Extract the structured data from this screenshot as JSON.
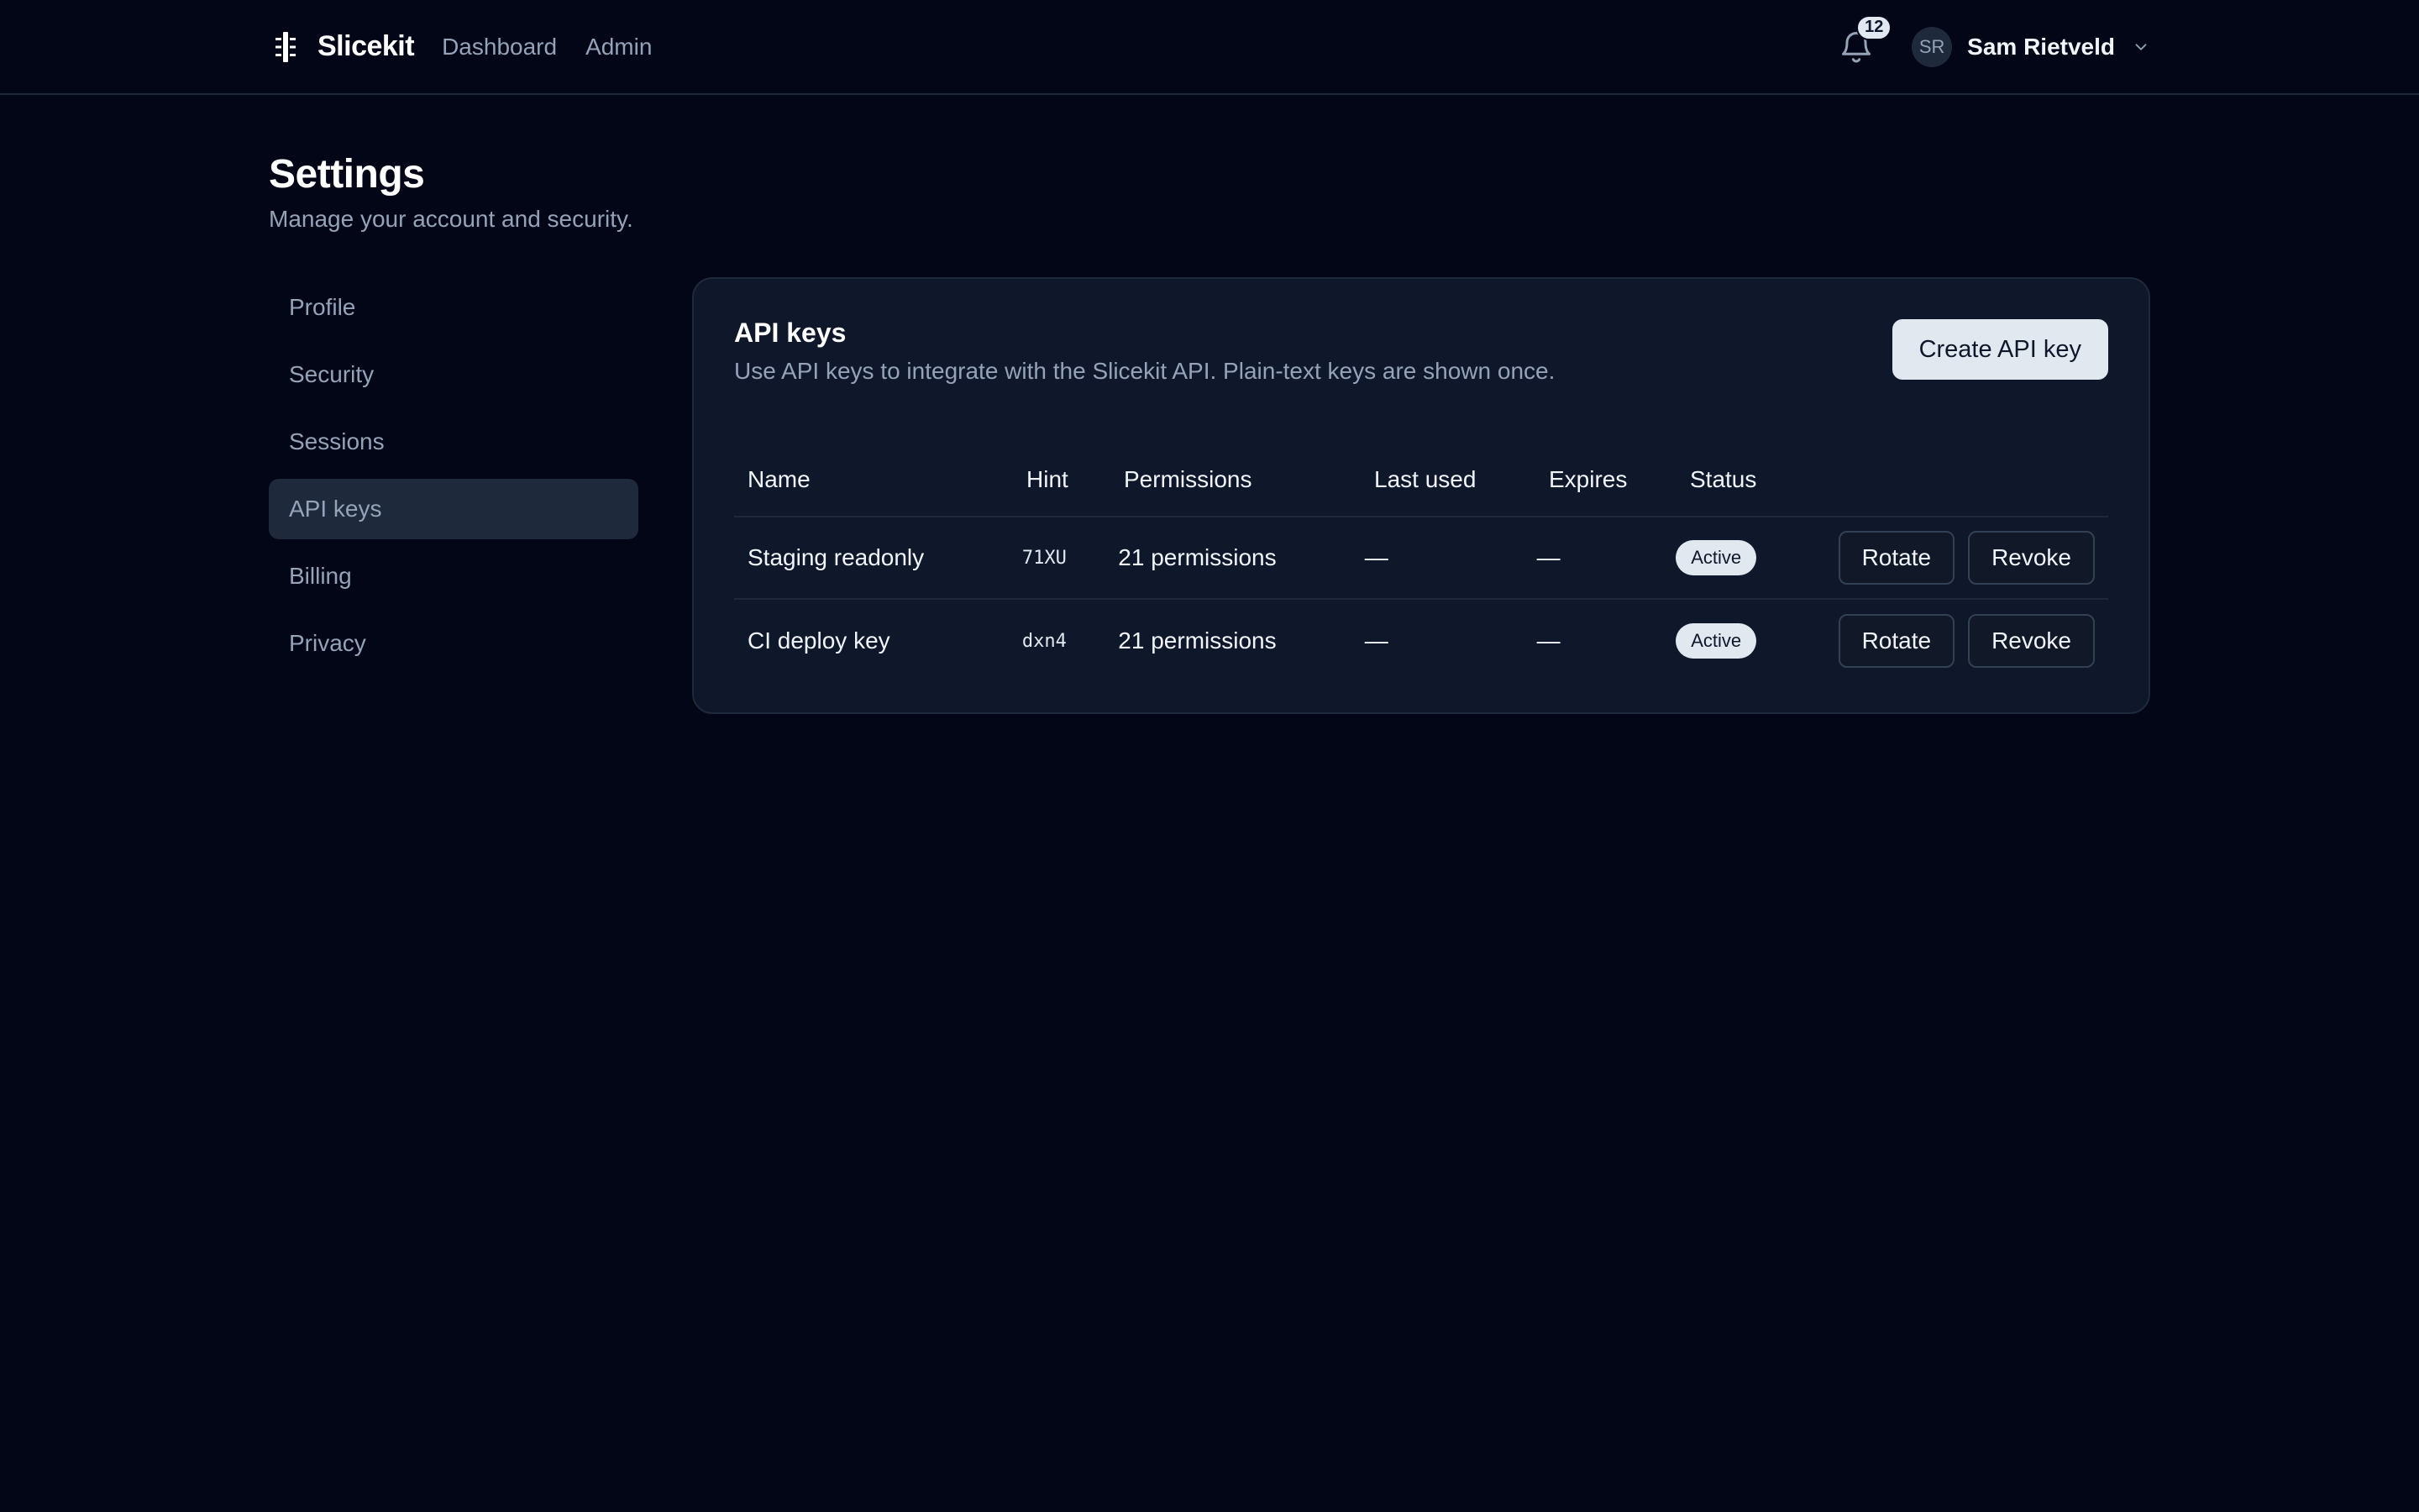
{
  "app": {
    "name": "Slicekit",
    "nav": [
      {
        "label": "Dashboard"
      },
      {
        "label": "Admin"
      }
    ],
    "notifications_count": "12",
    "user": {
      "initials": "SR",
      "name": "Sam Rietveld"
    }
  },
  "page": {
    "title": "Settings",
    "subtitle": "Manage your account and security."
  },
  "sidebar": {
    "items": [
      {
        "label": "Profile"
      },
      {
        "label": "Security"
      },
      {
        "label": "Sessions"
      },
      {
        "label": "API keys"
      },
      {
        "label": "Billing"
      },
      {
        "label": "Privacy"
      }
    ],
    "active": "API keys"
  },
  "api_keys": {
    "title": "API keys",
    "description": "Use API keys to integrate with the Slicekit API. Plain-text keys are shown once.",
    "create_label": "Create API key",
    "columns": [
      "Name",
      "Hint",
      "Permissions",
      "Last used",
      "Expires",
      "Status"
    ],
    "rows": [
      {
        "name": "Staging readonly",
        "hint": "71XU",
        "permissions": "21 permissions",
        "last_used": "—",
        "expires": "—",
        "status": "Active",
        "rotate_label": "Rotate",
        "revoke_label": "Revoke"
      },
      {
        "name": "CI deploy key",
        "hint": "dxn4",
        "permissions": "21 permissions",
        "last_used": "—",
        "expires": "—",
        "status": "Active",
        "rotate_label": "Rotate",
        "revoke_label": "Revoke"
      }
    ]
  },
  "colors": {
    "background": "#020617",
    "card": "#0f172a",
    "border": "#1e293b",
    "muted_text": "#94a3b8",
    "primary_button": "#e2e8f0"
  },
  "icons": {
    "logo": "slicekit-logo-icon",
    "notifications": "bell-icon",
    "user_menu": "chevron-down-icon"
  }
}
